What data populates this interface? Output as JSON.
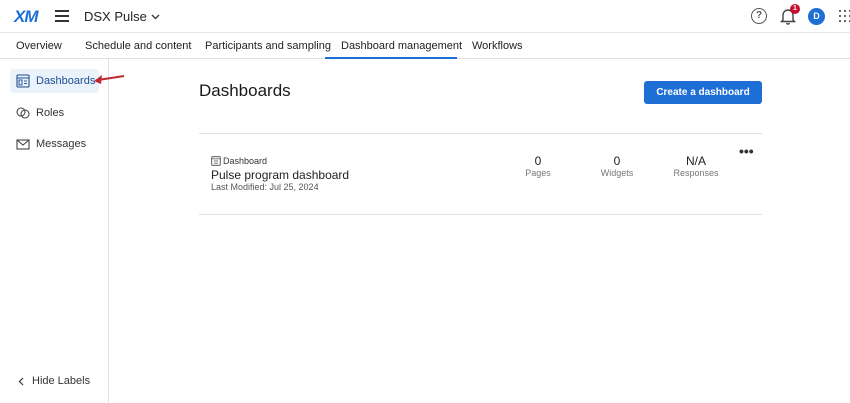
{
  "header": {
    "logo": "XM",
    "project_name": "DSX Pulse",
    "notification_count": "1",
    "avatar_initial": "D"
  },
  "tabs": [
    {
      "label": "Overview"
    },
    {
      "label": "Schedule and content"
    },
    {
      "label": "Participants and sampling"
    },
    {
      "label": "Dashboard management",
      "active": true
    },
    {
      "label": "Workflows"
    }
  ],
  "sidebar": {
    "items": [
      {
        "label": "Dashboards",
        "icon": "dashboard-icon",
        "active": true
      },
      {
        "label": "Roles",
        "icon": "roles-icon"
      },
      {
        "label": "Messages",
        "icon": "envelope-icon"
      }
    ],
    "hide_labels": "Hide Labels"
  },
  "main": {
    "title": "Dashboards",
    "create_button": "Create a dashboard",
    "dashboard": {
      "type_label": "Dashboard",
      "name": "Pulse program dashboard",
      "last_modified": "Last Modified: Jul 25, 2024",
      "stats": [
        {
          "value": "0",
          "label": "Pages"
        },
        {
          "value": "0",
          "label": "Widgets"
        },
        {
          "value": "N/A",
          "label": "Responses"
        }
      ],
      "more_label": "•••"
    }
  },
  "colors": {
    "accent": "#1d6fd6",
    "active_bg": "#eaf2fc",
    "badge": "#c8102e",
    "arrow": "#c0282d"
  }
}
